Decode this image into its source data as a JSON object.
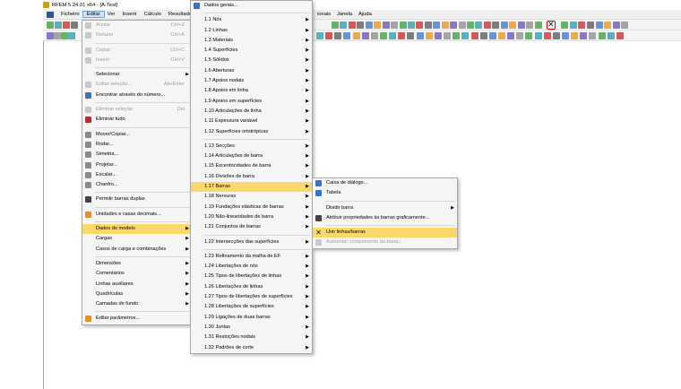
{
  "window": {
    "title": "RFEM 5.24.01 x64 - [A-Test]"
  },
  "menubar": {
    "items": [
      {
        "label": "Ficheiro"
      },
      {
        "label": "Editar",
        "active": true
      },
      {
        "label": "Ver"
      },
      {
        "label": "Inserir"
      },
      {
        "label": "Cálculo"
      },
      {
        "label": "Resultado"
      }
    ],
    "right_items": [
      {
        "label": "ionais"
      },
      {
        "label": "Janela"
      },
      {
        "label": "Ajuda"
      }
    ]
  },
  "toolbar": {
    "highlighted_tool": "Unir linhas/barras",
    "highlight_color": "#d40000"
  },
  "edit_menu": {
    "items": [
      {
        "label": "Anular",
        "shortcut": "Ctrl+Z",
        "disabled": true,
        "icon": "undo-icon"
      },
      {
        "label": "Refazer",
        "shortcut": "Ctrl+A",
        "disabled": true,
        "icon": "redo-icon"
      },
      {
        "sep": true
      },
      {
        "label": "Copiar",
        "shortcut": "Ctrl+C",
        "disabled": true,
        "icon": "copy-icon"
      },
      {
        "label": "Inserir",
        "shortcut": "Ctrl+V",
        "disabled": true,
        "icon": "paste-icon"
      },
      {
        "sep": true
      },
      {
        "label": "Selecionar",
        "submenu": true
      },
      {
        "label": "Editar seleção...",
        "shortcut": "Alt+Enter",
        "disabled": true,
        "icon": "edit-selection-icon"
      },
      {
        "label": "Encontrar através do número...",
        "icon": "find-icon"
      },
      {
        "sep": true
      },
      {
        "label": "Eliminar seleção",
        "shortcut": "Del",
        "disabled": true,
        "icon": "delete-icon"
      },
      {
        "label": "Eliminar tudo",
        "icon": "delete-all-icon"
      },
      {
        "sep": true
      },
      {
        "label": "Mover/Copiar...",
        "icon": "move-icon"
      },
      {
        "label": "Rodar...",
        "icon": "rotate-icon"
      },
      {
        "label": "Simetria...",
        "icon": "mirror-icon"
      },
      {
        "label": "Projetar...",
        "icon": "project-icon"
      },
      {
        "label": "Escalar...",
        "icon": "scale-icon"
      },
      {
        "label": "Chanfro...",
        "icon": "chamfer-icon"
      },
      {
        "sep": true
      },
      {
        "label": "Permitir barras duplas",
        "icon": "double-members-icon"
      },
      {
        "sep": true
      },
      {
        "label": "Unidades e casas decimais...",
        "icon": "units-icon"
      },
      {
        "sep": true
      },
      {
        "label": "Dados do modelo",
        "submenu": true,
        "highlight": true
      },
      {
        "label": "Cargas",
        "submenu": true
      },
      {
        "label": "Casos de carga e combinações",
        "submenu": true
      },
      {
        "sep": true
      },
      {
        "label": "Dimensões",
        "submenu": true
      },
      {
        "label": "Comentários",
        "submenu": true
      },
      {
        "label": "Linhas auxiliares",
        "submenu": true
      },
      {
        "label": "Quadrículas",
        "submenu": true
      },
      {
        "label": "Camadas de fundo",
        "submenu": true
      },
      {
        "sep": true
      },
      {
        "label": "Editar parâmetros...",
        "icon": "parameters-icon"
      }
    ]
  },
  "model_data_menu": {
    "items": [
      {
        "label": "Dados gerais...",
        "icon": "general-data-icon"
      },
      {
        "sep": true
      },
      {
        "label": "1.1 Nós",
        "submenu": true
      },
      {
        "label": "1.2 Linhas",
        "submenu": true
      },
      {
        "label": "1.3 Materiais",
        "submenu": true
      },
      {
        "label": "1.4 Superfícies",
        "submenu": true
      },
      {
        "label": "1.5 Sólidos",
        "submenu": true
      },
      {
        "label": "1.6 Aberturas",
        "submenu": true
      },
      {
        "label": "1.7 Apoios nodais",
        "submenu": true
      },
      {
        "label": "1.8 Apoios em linha",
        "submenu": true
      },
      {
        "label": "1.9 Apoios em superfícies",
        "submenu": true
      },
      {
        "label": "1.10 Articulações de linha",
        "submenu": true
      },
      {
        "label": "1.11 Espessura variável",
        "submenu": true
      },
      {
        "label": "1.12 Superfícies ortotrópicas",
        "submenu": true
      },
      {
        "sep": true
      },
      {
        "label": "1.13 Secções",
        "submenu": true
      },
      {
        "label": "1.14 Articulações de barra",
        "submenu": true
      },
      {
        "label": "1.15 Excentricidades de barra",
        "submenu": true
      },
      {
        "label": "1.16 Divisões de barra",
        "submenu": true
      },
      {
        "label": "1.17 Barras",
        "submenu": true,
        "highlight": true
      },
      {
        "label": "1.18 Nervuras",
        "submenu": true
      },
      {
        "label": "1.19 Fundações elásticas de barras",
        "submenu": true
      },
      {
        "label": "1.20 Não-linearidades de barra",
        "submenu": true
      },
      {
        "label": "1.21 Conjuntos de barras",
        "submenu": true
      },
      {
        "sep": true
      },
      {
        "label": "1.22 Intersecções das superfícies",
        "submenu": true
      },
      {
        "sep": true
      },
      {
        "label": "1.23 Refinamento da malha de EF",
        "submenu": true
      },
      {
        "label": "1.24 Libertações de nós",
        "submenu": true
      },
      {
        "label": "1.25 Tipos de libertações de linhas",
        "submenu": true
      },
      {
        "label": "1.26 Libertações de linhas",
        "submenu": true
      },
      {
        "label": "1.27 Tipos de libertações de superfícies",
        "submenu": true
      },
      {
        "label": "1.28 Libertações de superfícies",
        "submenu": true
      },
      {
        "label": "1.29 Ligações de duas barras",
        "submenu": true
      },
      {
        "label": "1.30 Juntas",
        "submenu": true
      },
      {
        "label": "1.31 Restrições nodais",
        "submenu": true
      },
      {
        "label": "1.32 Padrões de corte",
        "submenu": true
      }
    ]
  },
  "members_menu": {
    "items": [
      {
        "label": "Caixa de diálogo...",
        "icon": "dialog-icon"
      },
      {
        "label": "Tabela",
        "icon": "table-icon"
      },
      {
        "sep": true
      },
      {
        "label": "Dividir barra",
        "submenu": true
      },
      {
        "label": "Atribuir propriedades às barras graficamente...",
        "icon": "assign-properties-icon"
      },
      {
        "sep": true
      },
      {
        "label": "Unir linhas/barras",
        "highlight": true,
        "icon": "join-members-icon"
      },
      {
        "label": "Aumentar comprimento da barra...",
        "disabled": true,
        "icon": "extend-member-icon"
      }
    ]
  }
}
